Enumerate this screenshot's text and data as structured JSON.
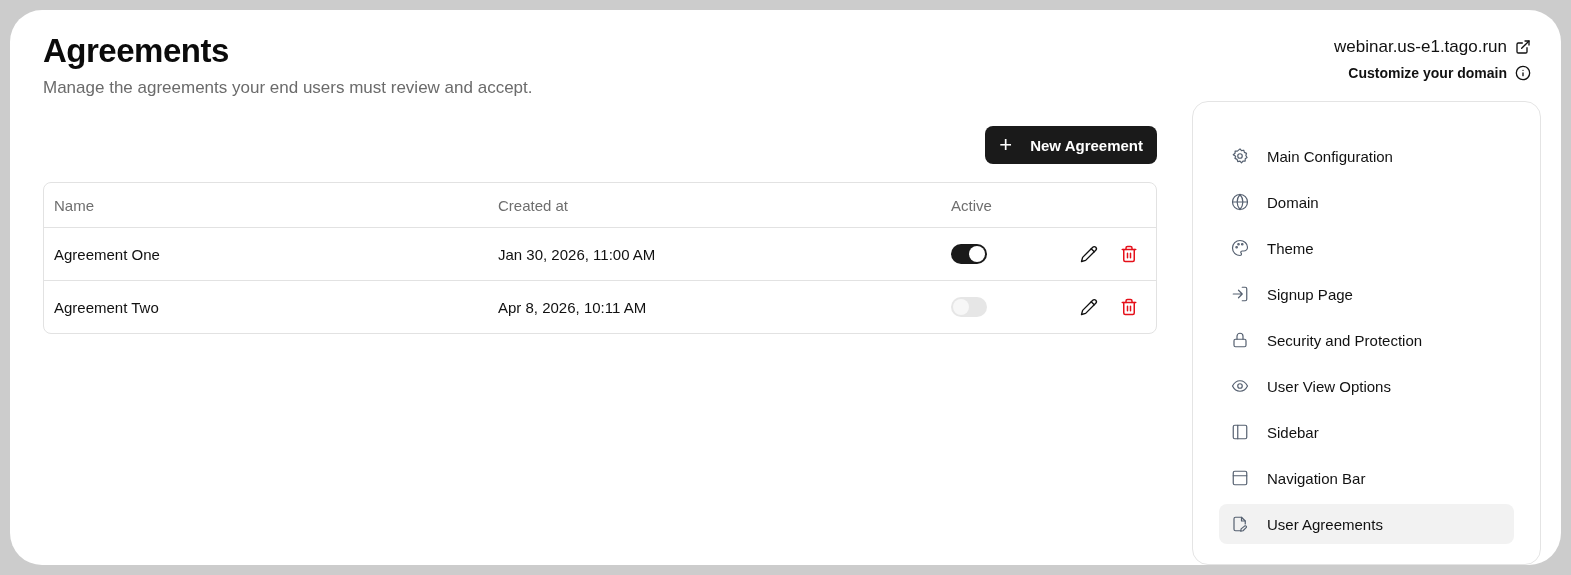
{
  "header": {
    "title": "Agreements",
    "subtitle": "Manage the agreements your end users must review and accept."
  },
  "domain": {
    "url": "webinar.us-e1.tago.run",
    "customize": "Customize your domain"
  },
  "new_button": {
    "icon_char": "+",
    "label": "New Agreement"
  },
  "table": {
    "columns": [
      "Name",
      "Created at",
      "Active"
    ],
    "rows": [
      {
        "name": "Agreement One",
        "created_at": "Jan 30, 2026, 11:00 AM",
        "active": true
      },
      {
        "name": "Agreement Two",
        "created_at": "Apr 8, 2026, 10:11 AM",
        "active": false
      }
    ]
  },
  "sidebar": {
    "items": [
      {
        "label": "Main Configuration",
        "selected": false
      },
      {
        "label": "Domain",
        "selected": false
      },
      {
        "label": "Theme",
        "selected": false
      },
      {
        "label": "Signup Page",
        "selected": false
      },
      {
        "label": "Security and Protection",
        "selected": false
      },
      {
        "label": "User View Options",
        "selected": false
      },
      {
        "label": "Sidebar",
        "selected": false
      },
      {
        "label": "Navigation Bar",
        "selected": false
      },
      {
        "label": "User Agreements",
        "selected": true
      }
    ]
  }
}
